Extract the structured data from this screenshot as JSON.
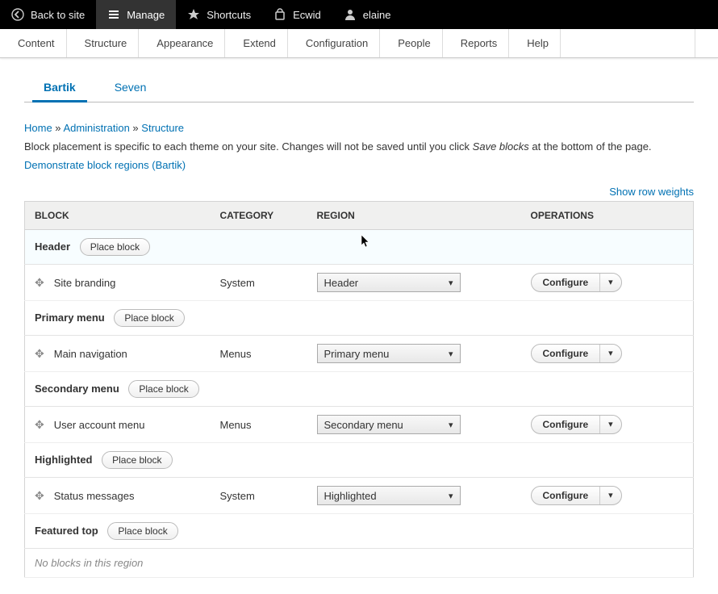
{
  "toolbar": {
    "back": "Back to site",
    "manage": "Manage",
    "shortcuts": "Shortcuts",
    "ecwid": "Ecwid",
    "user": "elaine"
  },
  "adminmenu": {
    "content": "Content",
    "structure": "Structure",
    "appearance": "Appearance",
    "extend": "Extend",
    "configuration": "Configuration",
    "people": "People",
    "reports": "Reports",
    "help": "Help"
  },
  "tabs": {
    "bartik": "Bartik",
    "seven": "Seven"
  },
  "breadcrumb": {
    "home": "Home",
    "admin": "Administration",
    "structure": "Structure",
    "sep": " » "
  },
  "desc": {
    "part1": "Block placement is specific to each theme on your site. Changes will not be saved until you click ",
    "emph": "Save blocks",
    "part2": " at the bottom of the page."
  },
  "links": {
    "demo": "Demonstrate block regions (Bartik)",
    "rowweights": "Show row weights"
  },
  "headers": {
    "block": "BLOCK",
    "category": "CATEGORY",
    "region": "REGION",
    "operations": "OPERATIONS"
  },
  "labels": {
    "place_block": "Place block",
    "configure": "Configure",
    "empty": "No blocks in this region"
  },
  "regions": {
    "header": "Header",
    "primary_menu": "Primary menu",
    "secondary_menu": "Secondary menu",
    "highlighted": "Highlighted",
    "featured_top": "Featured top"
  },
  "blocks": {
    "site_branding": {
      "name": "Site branding",
      "category": "System",
      "region": "Header"
    },
    "main_navigation": {
      "name": "Main navigation",
      "category": "Menus",
      "region": "Primary menu"
    },
    "user_account_menu": {
      "name": "User account menu",
      "category": "Menus",
      "region": "Secondary menu"
    },
    "status_messages": {
      "name": "Status messages",
      "category": "System",
      "region": "Highlighted"
    }
  }
}
